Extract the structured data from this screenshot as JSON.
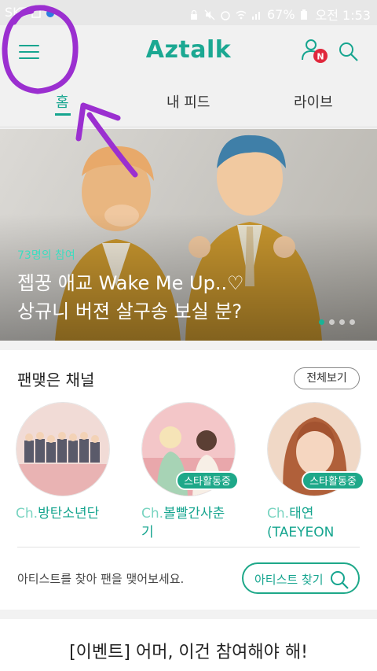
{
  "status_bar": {
    "carrier": "SKT",
    "battery": "67%",
    "time": "오전 1:53"
  },
  "header": {
    "brand": "Aztalk",
    "notification_badge": "N"
  },
  "tabs": [
    {
      "label": "홈",
      "active": true
    },
    {
      "label": "내 피드",
      "active": false
    },
    {
      "label": "라이브",
      "active": false
    }
  ],
  "hero": {
    "count_text": "73명의 참여",
    "title_line1": "젭꿍 애교 Wake Me Up..♡",
    "title_line2": "상규니 버젼 살구송 보실 분?",
    "slides": 4,
    "active_slide": 0
  },
  "channels": {
    "title": "팬맺은 채널",
    "view_all_label": "전체보기",
    "items": [
      {
        "prefix": "Ch.",
        "name": "방탄소년단",
        "badge": ""
      },
      {
        "prefix": "Ch.",
        "name": "볼빨간사춘\n기",
        "badge": "스타활동중"
      },
      {
        "prefix": "Ch.",
        "name": "태연\n(TAEYEON",
        "badge": "스타활동중"
      }
    ],
    "find_prompt": "아티스트를 찾아 팬을 맺어보세요.",
    "find_button_label": "아티스트 찾기"
  },
  "event": {
    "title": "[이벤트] 어머, 이건 참여해야 해!"
  },
  "colors": {
    "accent": "#1ba892",
    "annotation": "#9b2fd0"
  }
}
